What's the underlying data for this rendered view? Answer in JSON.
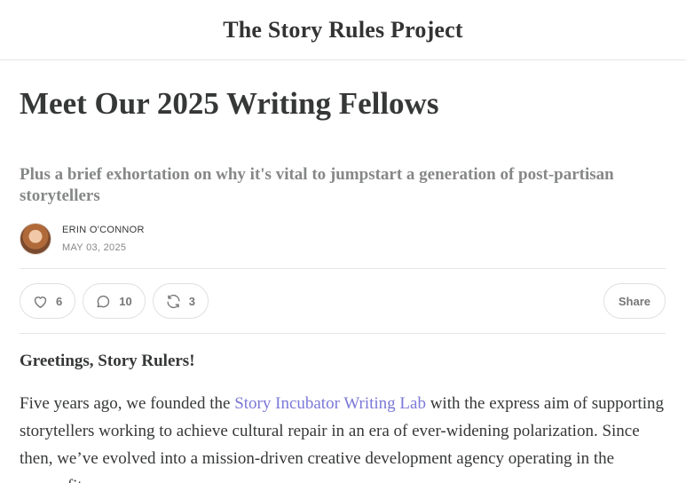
{
  "site": {
    "title": "The Story Rules Project"
  },
  "post": {
    "title": "Meet Our 2025 Writing Fellows",
    "subtitle": "Plus a brief exhortation on why it's vital to jumpstart a generation of post-partisan storytellers",
    "author": "ERIN O'CONNOR",
    "date": "MAY 03, 2025"
  },
  "actions": {
    "likes": {
      "icon": "heart-icon",
      "count": "6"
    },
    "comments": {
      "icon": "comment-icon",
      "count": "10"
    },
    "restacks": {
      "icon": "restack-icon",
      "count": "3"
    },
    "share_label": "Share"
  },
  "content": {
    "greeting": "Greetings, Story Rulers!",
    "p1_before": "Five years ago, we founded the ",
    "p1_link": "Story Incubator Writing Lab",
    "p1_after": " with the express aim of supporting storytellers working to achieve cultural repair in an era of ever-widening polarization. Since then, we’ve evolved into a mission-driven creative development agency operating in the nonprofit space."
  },
  "colors": {
    "link": "#7b78d8",
    "text": "#363737",
    "muted": "#868787"
  }
}
